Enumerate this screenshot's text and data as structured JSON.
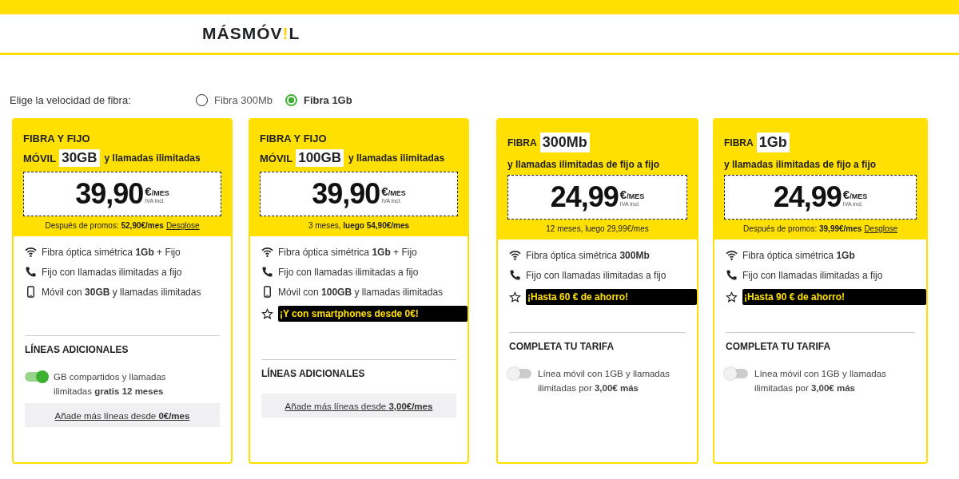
{
  "logo": {
    "before": "MÁSMÓV",
    "accent": "!",
    "after": "L"
  },
  "speed": {
    "label": "Elige la velocidad de fibra:",
    "options": [
      {
        "label": "Fibra 300Mb",
        "selected": false
      },
      {
        "label": "Fibra 1Gb",
        "selected": true
      }
    ]
  },
  "cards": [
    {
      "title": "FIBRA Y FIJO",
      "prefix": "MÓVIL",
      "highlight": "30GB",
      "suffix": "y llamadas ilimitadas",
      "price": "39,90",
      "currency": "€",
      "per": "/MES",
      "tax": "IVA incl.",
      "note": "Después de promos: **52,90€/mes**",
      "note_link": "Desglose",
      "features": [
        {
          "kind": "wifi",
          "text": "Fibra óptica simétrica **1Gb** + Fijo"
        },
        {
          "kind": "phone",
          "text": "Fijo con llamadas ilimitadas a fijo"
        },
        {
          "kind": "mobile",
          "text": "Móvil con **30GB** y llamadas ilimitadas"
        }
      ],
      "section": {
        "title": "LÍNEAS ADICIONALES",
        "toggle": {
          "on": true,
          "text": "GB compartidos y llamadas ilimitadas **gratis 12 meses**"
        },
        "link": "Añade más líneas desde **0€/mes**"
      }
    },
    {
      "title": "FIBRA Y FIJO",
      "prefix": "MÓVIL",
      "highlight": "100GB",
      "suffix": "y llamadas ilimitadas",
      "price": "39,90",
      "currency": "€",
      "per": "/MES",
      "tax": "IVA incl.",
      "note": "3 meses, **luego 54,90€/mes**",
      "features": [
        {
          "kind": "wifi",
          "text": "Fibra óptica simétrica **1Gb** + Fijo"
        },
        {
          "kind": "phone",
          "text": "Fijo con llamadas ilimitadas a fijo"
        },
        {
          "kind": "mobile",
          "text": "Móvil con **100GB** y llamadas ilimitadas"
        },
        {
          "kind": "promo",
          "text": "¡Y con smartphones desde 0€!"
        }
      ],
      "section": {
        "title": "LÍNEAS ADICIONALES",
        "link": "Añade más líneas desde **3,00€/mes**"
      }
    },
    {
      "prefix": "FIBRA",
      "highlight": "300Mb",
      "subtitle": "y llamadas ilimitadas de fijo a fijo",
      "price": "24,99",
      "currency": "€",
      "per": "/MES",
      "tax": "IVA incl.",
      "note": "12 meses, luego 29,99€/mes",
      "features": [
        {
          "kind": "wifi",
          "text": "Fibra óptica simétrica **300Mb**"
        },
        {
          "kind": "phone",
          "text": "Fijo con llamadas ilimitadas a fijo"
        },
        {
          "kind": "promo",
          "text": "¡Hasta 60 € de ahorro!"
        }
      ],
      "section": {
        "title": "COMPLETA TU TARIFA",
        "toggle": {
          "on": false,
          "text": "Línea móvil con 1GB y llamadas ilimitadas por **3,00€ más**"
        }
      }
    },
    {
      "prefix": "FIBRA",
      "highlight": "1Gb",
      "subtitle": "y llamadas ilimitadas de fijo a fijo",
      "price": "24,99",
      "currency": "€",
      "per": "/MES",
      "tax": "IVA incl.",
      "note": "Después de promos: **39,99€/mes**",
      "note_link": "Desglose",
      "features": [
        {
          "kind": "wifi",
          "text": "Fibra óptica simétrica **1Gb**"
        },
        {
          "kind": "phone",
          "text": "Fijo con llamadas ilimitadas a fijo"
        },
        {
          "kind": "promo",
          "text": "¡Hasta 90 € de ahorro!"
        }
      ],
      "section": {
        "title": "COMPLETA TU TARIFA",
        "toggle": {
          "on": false,
          "text": "Línea móvil con 1GB y llamadas ilimitadas por **3,00€ más**"
        }
      }
    }
  ]
}
